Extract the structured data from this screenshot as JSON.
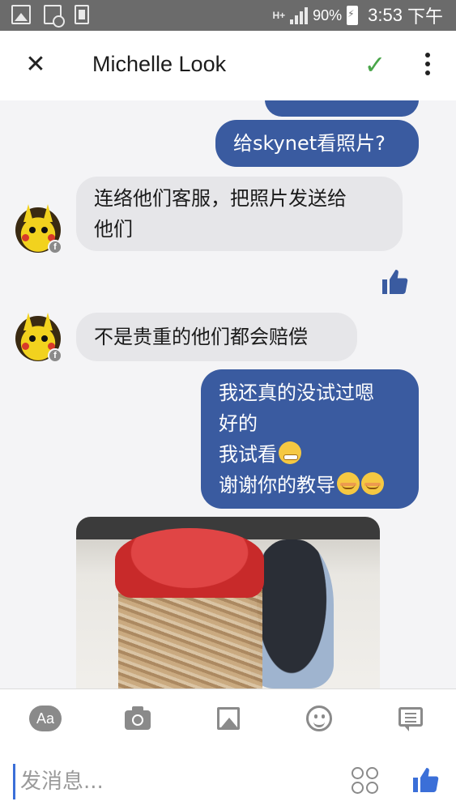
{
  "status_bar": {
    "network": "H+",
    "battery": "90%",
    "time": "3:53",
    "ampm": "下午",
    "icons": [
      "gallery-icon",
      "screenshot-icon",
      "document-icon"
    ]
  },
  "header": {
    "title": "Michelle Look"
  },
  "messages": [
    {
      "side": "out",
      "text": "给skynet看照片?"
    },
    {
      "side": "in",
      "lines": [
        "连络他们客服，把照片发送给",
        "他们"
      ]
    },
    {
      "side": "in",
      "lines": [
        "不是贵重的他们都会赔偿"
      ]
    },
    {
      "side": "out",
      "lines": [
        "我还真的没试过嗯",
        "好的",
        "我试看",
        "谢谢你的教导"
      ]
    }
  ],
  "composer": {
    "text_tool": "Aa",
    "placeholder": "发消息..."
  },
  "colors": {
    "accent": "#3a5ba0",
    "check": "#4aa64a",
    "incoming_bubble": "#e6e6e9"
  }
}
